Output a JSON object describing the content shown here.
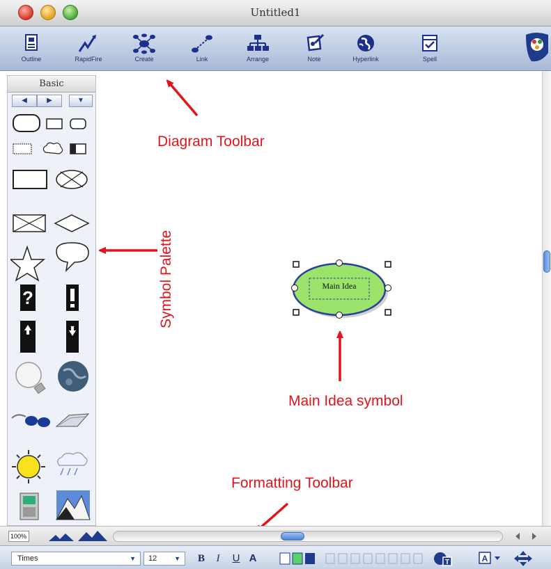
{
  "window": {
    "title": "Untitled1"
  },
  "toolbar": {
    "items": [
      {
        "label": "Outline",
        "icon": "outline-icon"
      },
      {
        "label": "RapidFire",
        "icon": "rapidfire-icon"
      },
      {
        "label": "Create",
        "icon": "create-icon"
      },
      {
        "label": "Link",
        "icon": "link-icon"
      },
      {
        "label": "Arrange",
        "icon": "arrange-icon"
      },
      {
        "label": "Note",
        "icon": "note-icon"
      },
      {
        "label": "Hyperlink",
        "icon": "hyperlink-icon"
      },
      {
        "label": "Spell",
        "icon": "spell-icon"
      }
    ]
  },
  "palette": {
    "title": "Basic",
    "nav_prev": "◀",
    "nav_next": "▶",
    "nav_menu": "▼"
  },
  "canvas": {
    "symbol_text": "Main Idea"
  },
  "annotations": {
    "diagram_toolbar": "Diagram Toolbar",
    "symbol_palette": "Symbol Palette",
    "main_idea_symbol": "Main Idea symbol",
    "formatting_toolbar": "Formatting Toolbar"
  },
  "statusbar": {
    "zoom": "100%"
  },
  "formatting": {
    "font": "Times",
    "size": "12",
    "bold": "B",
    "italic": "I",
    "underline": "U",
    "text_color": "A"
  },
  "colors": {
    "annotation_red": "#e1141b",
    "symbol_fill": "#9be36a",
    "symbol_stroke": "#2b3fa0"
  }
}
